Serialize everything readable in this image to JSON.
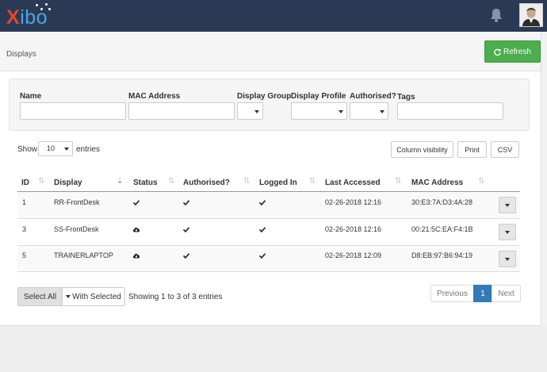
{
  "app": {
    "logo_x": "X",
    "logo_rest": "ibo"
  },
  "header": {
    "title": "Displays",
    "refresh_label": "Refresh"
  },
  "filters": {
    "name_label": "Name",
    "mac_label": "MAC Address",
    "group_label": "Display Group",
    "profile_label": "Display Profile",
    "authorised_label": "Authorised?",
    "tags_label": "Tags"
  },
  "table_controls": {
    "show_label": "Show",
    "entries_value": "10",
    "entries_label": "entries",
    "column_visibility": "Column visibility",
    "print": "Print",
    "csv": "CSV"
  },
  "table": {
    "columns": [
      "ID",
      "Display",
      "Status",
      "Authorised?",
      "Logged In",
      "Last Accessed",
      "MAC Address"
    ],
    "rows": [
      {
        "id": "1",
        "display": "RR-FrontDesk",
        "status": "check",
        "authorised": true,
        "logged_in": true,
        "last_accessed": "02-26-2018 12:16",
        "mac": "30:E3:7A:D3:4A:28"
      },
      {
        "id": "3",
        "display": "SS-FrontDesk",
        "status": "cloud",
        "authorised": true,
        "logged_in": true,
        "last_accessed": "02-26-2018 12:16",
        "mac": "00:21:5C:EA:F4:1B"
      },
      {
        "id": "5",
        "display": "TRAINERLAPTOP",
        "status": "cloud",
        "authorised": true,
        "logged_in": true,
        "last_accessed": "02-26-2018 12:09",
        "mac": "D8:EB:97:B6:94:19"
      }
    ]
  },
  "footer": {
    "select_all": "Select All",
    "with_selected": "With Selected",
    "info": "Showing 1 to 3 of 3 entries",
    "previous": "Previous",
    "current_page": "1",
    "next": "Next"
  },
  "colors": {
    "topbar": "#2a3a55",
    "refresh": "#4cae4c",
    "pagination_active": "#337ab7"
  }
}
